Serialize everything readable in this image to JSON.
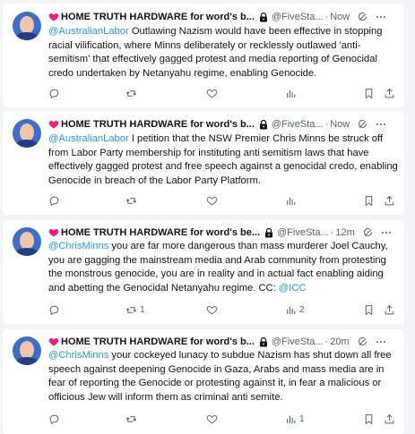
{
  "colors": {
    "accent": "#1d9bf0",
    "muted": "#536471",
    "text": "#0f1419",
    "heart": "#f91880"
  },
  "tweets": [
    {
      "display_name": "HOME TRUTH HARDWARE for word's b...",
      "handle": "@FiveSta...",
      "dot": "·",
      "time": "Now",
      "mention": "@AustralianLabor",
      "text": " Outlawing Nazism would have been effective in stopping racial vilification, where Minns deliberately or recklessly outlawed 'anti-semitism' that effectively gagged protest and media reporting of Genocidal credo undertaken by Netanyahu regime, enabling Genocide.",
      "trailing_mention": "",
      "retweets": "",
      "views": ""
    },
    {
      "display_name": "HOME TRUTH HARDWARE for word's b...",
      "handle": "@FiveSta...",
      "dot": "·",
      "time": "Now",
      "mention": "@AustralianLabor",
      "text": " I petition that the NSW Premier Chris Minns be struck off from Labor Party membership for instituting anti semitism laws that have effectively gagged protest and free speech against a genocidal credo, enabling Genocide in breach of the Labor Party Platform.",
      "trailing_mention": "",
      "retweets": "",
      "views": ""
    },
    {
      "display_name": "HOME TRUTH HARDWARE for word's be...",
      "handle": "@FiveSta...",
      "dot": "·",
      "time": "12m",
      "mention": "@ChrisMinns",
      "text": " you are far more dangerous than mass murderer Joel Cauchy, you are gagging the mainstream media and Arab community from protesting the monstrous genocide, you are in reality and in actual fact enabling aiding and abetting the Genocidal Netanyahu regime. CC: ",
      "trailing_mention": "@ICC",
      "retweets": "1",
      "views": "2"
    },
    {
      "display_name": "HOME TRUTH HARDWARE for word's b...",
      "handle": "@FiveSta...",
      "dot": "·",
      "time": "20m",
      "mention": "@ChrisMinns",
      "text": " your cockeyed lunacy to subdue Nazism has shut down all free speech against deepening Genocide in Gaza, Arabs and mass media are in fear of reporting the Genocide or protesting against it, in fear a malicious or officious Jew will inform them as criminal anti semite.",
      "trailing_mention": "",
      "retweets": "",
      "views": "1"
    }
  ]
}
